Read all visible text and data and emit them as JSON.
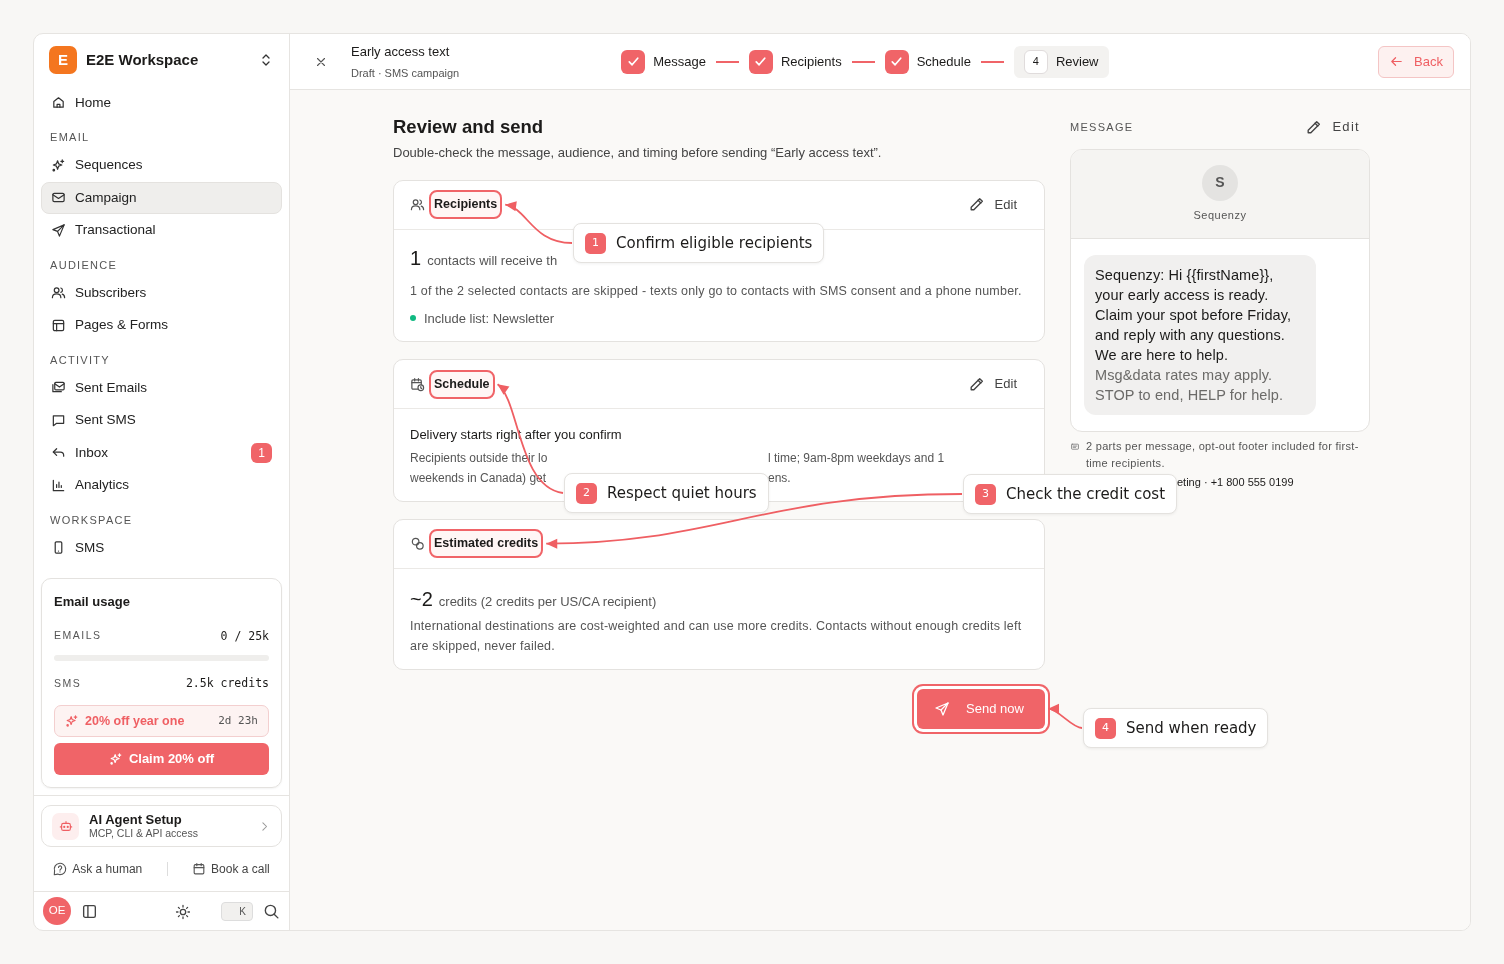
{
  "workspace": {
    "initial": "E",
    "name": "E2E Workspace"
  },
  "nav": [
    {
      "kind": "item",
      "label": "Home",
      "selected": false
    },
    {
      "kind": "section",
      "label": "EMAIL"
    },
    {
      "kind": "item",
      "label": "Sequences",
      "selected": false
    },
    {
      "kind": "item",
      "label": "Campaign",
      "selected": true
    },
    {
      "kind": "item",
      "label": "Transactional",
      "selected": false
    },
    {
      "kind": "section",
      "label": "AUDIENCE"
    },
    {
      "kind": "item",
      "label": "Subscribers",
      "selected": false
    },
    {
      "kind": "item",
      "label": "Pages & Forms",
      "selected": false
    },
    {
      "kind": "section",
      "label": "ACTIVITY"
    },
    {
      "kind": "item",
      "label": "Sent Emails",
      "selected": false
    },
    {
      "kind": "item",
      "label": "Sent SMS",
      "selected": false
    },
    {
      "kind": "item",
      "label": "Inbox",
      "selected": false,
      "badge": "1"
    },
    {
      "kind": "item",
      "label": "Analytics",
      "selected": false
    },
    {
      "kind": "section",
      "label": "WORKSPACE"
    },
    {
      "kind": "item",
      "label": "SMS",
      "selected": false
    }
  ],
  "usage": {
    "title": "Email usage",
    "rows": [
      {
        "label": "EMAILS",
        "value": "0 / 25k",
        "level": 0
      },
      {
        "label": "SMS",
        "value": "2.5k credits"
      }
    ],
    "promo": {
      "label": "20% off year one",
      "timer": "2d 23h"
    },
    "claim": "Claim 20% off"
  },
  "agent": {
    "title": "AI Agent Setup",
    "subtitle": "MCP, CLI & API access"
  },
  "help_links": [
    "Ask a human",
    "Book a call"
  ],
  "footer": {
    "avatar": "OE",
    "shortcut_key": "K"
  },
  "header": {
    "title": "Early access text",
    "subtitle": "Draft · SMS campaign",
    "steps": [
      {
        "label": "Message",
        "done": true,
        "selected": false
      },
      {
        "label": "Recipients",
        "done": true,
        "selected": false
      },
      {
        "label": "Schedule",
        "done": true,
        "selected": false
      },
      {
        "label": "Review",
        "number": "4",
        "done": false,
        "selected": true
      }
    ],
    "back": "Back"
  },
  "review": {
    "title": "Review and send",
    "intro": "Double-check the message, audience, and timing before sending “Early access text”.",
    "recipients": {
      "title": "Recipients",
      "highlighted": true,
      "edit": "Edit",
      "count": "1",
      "count_text": "contacts will receive th",
      "note": "1 of the 2 selected contacts are skipped - texts only go to contacts with SMS consent and a phone number.",
      "tag": {
        "label": "Include list: Newsletter",
        "color": "#10b981"
      }
    },
    "schedule": {
      "title": "Schedule",
      "highlighted": true,
      "edit": "Edit",
      "headline": "Delivery starts right after you confirm",
      "note_lines": [
        [
          "Recipients outside their lo",
          "l time; 9am-8pm weekdays and 1"
        ],
        [
          "weekends in Canada) get",
          "ens."
        ]
      ]
    },
    "credits": {
      "title": "Estimated credits",
      "highlighted": true,
      "count": "~2",
      "count_text": "credits (2 credits per US/CA recipient)",
      "note": "International destinations are cost-weighted and can use more credits. Contacts without enough credits left are skipped, never failed."
    },
    "send": {
      "label": "Send now",
      "highlighted": true
    }
  },
  "message": {
    "label": "MESSAGE",
    "edit": "Edit",
    "sender_initial": "S",
    "sender": "Sequenzy",
    "body": "Sequenzy: Hi {{firstName}}, your early access is ready. Claim your spot before Friday, and reply with any questions. We are here to help.",
    "footer_text": "Msg&data rates may apply. STOP to end, HELP for help.",
    "note": "2 parts per message, opt-out footer included for first-time recipients.",
    "sender_line": "eting · +1 800 555 0199"
  },
  "callouts": [
    {
      "number": "1",
      "text": "Confirm eligible recipients"
    },
    {
      "number": "2",
      "text": "Respect quiet hours"
    },
    {
      "number": "3",
      "text": "Check the credit cost"
    },
    {
      "number": "4",
      "text": "Send when ready"
    }
  ]
}
